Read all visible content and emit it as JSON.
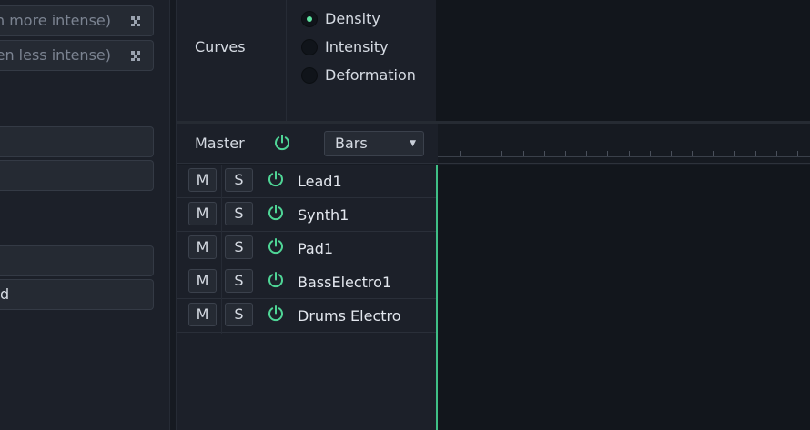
{
  "left_panel": {
    "buttons": [
      {
        "text": "ven more intense)",
        "icon": "dice-icon"
      },
      {
        "text": "ven less intense)",
        "icon": "dice-icon"
      },
      {
        "text": ""
      },
      {
        "text": ""
      },
      {
        "text": ""
      },
      {
        "text": "d"
      }
    ]
  },
  "curves": {
    "label": "Curves",
    "options": [
      {
        "label": "Density",
        "selected": true
      },
      {
        "label": "Intensity",
        "selected": false
      },
      {
        "label": "Deformation",
        "selected": false
      }
    ]
  },
  "master": {
    "label": "Master",
    "power_on": true,
    "grid_select": {
      "value": "Bars"
    }
  },
  "tracks": [
    {
      "mute_label": "M",
      "solo_label": "S",
      "name": "Lead1"
    },
    {
      "mute_label": "M",
      "solo_label": "S",
      "name": "Synth1"
    },
    {
      "mute_label": "M",
      "solo_label": "S",
      "name": "Pad1"
    },
    {
      "mute_label": "M",
      "solo_label": "S",
      "name": "BassElectro1"
    },
    {
      "mute_label": "M",
      "solo_label": "S",
      "name": "Drums Electro"
    }
  ],
  "colors": {
    "accent": "#5fe3a1",
    "playhead": "#3fbf86",
    "background": "#171b23"
  }
}
